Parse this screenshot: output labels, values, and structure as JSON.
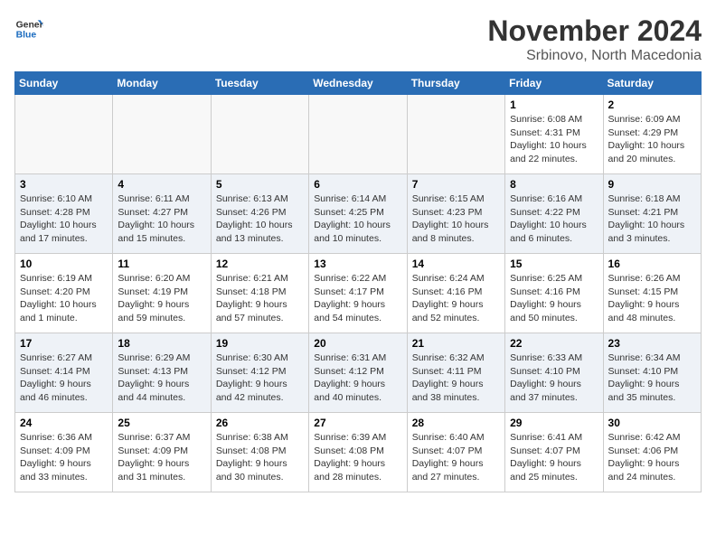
{
  "header": {
    "logo_line1": "General",
    "logo_line2": "Blue",
    "month_title": "November 2024",
    "location": "Srbinovo, North Macedonia"
  },
  "days_of_week": [
    "Sunday",
    "Monday",
    "Tuesday",
    "Wednesday",
    "Thursday",
    "Friday",
    "Saturday"
  ],
  "weeks": [
    [
      {
        "day": "",
        "info": ""
      },
      {
        "day": "",
        "info": ""
      },
      {
        "day": "",
        "info": ""
      },
      {
        "day": "",
        "info": ""
      },
      {
        "day": "",
        "info": ""
      },
      {
        "day": "1",
        "info": "Sunrise: 6:08 AM\nSunset: 4:31 PM\nDaylight: 10 hours\nand 22 minutes."
      },
      {
        "day": "2",
        "info": "Sunrise: 6:09 AM\nSunset: 4:29 PM\nDaylight: 10 hours\nand 20 minutes."
      }
    ],
    [
      {
        "day": "3",
        "info": "Sunrise: 6:10 AM\nSunset: 4:28 PM\nDaylight: 10 hours\nand 17 minutes."
      },
      {
        "day": "4",
        "info": "Sunrise: 6:11 AM\nSunset: 4:27 PM\nDaylight: 10 hours\nand 15 minutes."
      },
      {
        "day": "5",
        "info": "Sunrise: 6:13 AM\nSunset: 4:26 PM\nDaylight: 10 hours\nand 13 minutes."
      },
      {
        "day": "6",
        "info": "Sunrise: 6:14 AM\nSunset: 4:25 PM\nDaylight: 10 hours\nand 10 minutes."
      },
      {
        "day": "7",
        "info": "Sunrise: 6:15 AM\nSunset: 4:23 PM\nDaylight: 10 hours\nand 8 minutes."
      },
      {
        "day": "8",
        "info": "Sunrise: 6:16 AM\nSunset: 4:22 PM\nDaylight: 10 hours\nand 6 minutes."
      },
      {
        "day": "9",
        "info": "Sunrise: 6:18 AM\nSunset: 4:21 PM\nDaylight: 10 hours\nand 3 minutes."
      }
    ],
    [
      {
        "day": "10",
        "info": "Sunrise: 6:19 AM\nSunset: 4:20 PM\nDaylight: 10 hours\nand 1 minute."
      },
      {
        "day": "11",
        "info": "Sunrise: 6:20 AM\nSunset: 4:19 PM\nDaylight: 9 hours\nand 59 minutes."
      },
      {
        "day": "12",
        "info": "Sunrise: 6:21 AM\nSunset: 4:18 PM\nDaylight: 9 hours\nand 57 minutes."
      },
      {
        "day": "13",
        "info": "Sunrise: 6:22 AM\nSunset: 4:17 PM\nDaylight: 9 hours\nand 54 minutes."
      },
      {
        "day": "14",
        "info": "Sunrise: 6:24 AM\nSunset: 4:16 PM\nDaylight: 9 hours\nand 52 minutes."
      },
      {
        "day": "15",
        "info": "Sunrise: 6:25 AM\nSunset: 4:16 PM\nDaylight: 9 hours\nand 50 minutes."
      },
      {
        "day": "16",
        "info": "Sunrise: 6:26 AM\nSunset: 4:15 PM\nDaylight: 9 hours\nand 48 minutes."
      }
    ],
    [
      {
        "day": "17",
        "info": "Sunrise: 6:27 AM\nSunset: 4:14 PM\nDaylight: 9 hours\nand 46 minutes."
      },
      {
        "day": "18",
        "info": "Sunrise: 6:29 AM\nSunset: 4:13 PM\nDaylight: 9 hours\nand 44 minutes."
      },
      {
        "day": "19",
        "info": "Sunrise: 6:30 AM\nSunset: 4:12 PM\nDaylight: 9 hours\nand 42 minutes."
      },
      {
        "day": "20",
        "info": "Sunrise: 6:31 AM\nSunset: 4:12 PM\nDaylight: 9 hours\nand 40 minutes."
      },
      {
        "day": "21",
        "info": "Sunrise: 6:32 AM\nSunset: 4:11 PM\nDaylight: 9 hours\nand 38 minutes."
      },
      {
        "day": "22",
        "info": "Sunrise: 6:33 AM\nSunset: 4:10 PM\nDaylight: 9 hours\nand 37 minutes."
      },
      {
        "day": "23",
        "info": "Sunrise: 6:34 AM\nSunset: 4:10 PM\nDaylight: 9 hours\nand 35 minutes."
      }
    ],
    [
      {
        "day": "24",
        "info": "Sunrise: 6:36 AM\nSunset: 4:09 PM\nDaylight: 9 hours\nand 33 minutes."
      },
      {
        "day": "25",
        "info": "Sunrise: 6:37 AM\nSunset: 4:09 PM\nDaylight: 9 hours\nand 31 minutes."
      },
      {
        "day": "26",
        "info": "Sunrise: 6:38 AM\nSunset: 4:08 PM\nDaylight: 9 hours\nand 30 minutes."
      },
      {
        "day": "27",
        "info": "Sunrise: 6:39 AM\nSunset: 4:08 PM\nDaylight: 9 hours\nand 28 minutes."
      },
      {
        "day": "28",
        "info": "Sunrise: 6:40 AM\nSunset: 4:07 PM\nDaylight: 9 hours\nand 27 minutes."
      },
      {
        "day": "29",
        "info": "Sunrise: 6:41 AM\nSunset: 4:07 PM\nDaylight: 9 hours\nand 25 minutes."
      },
      {
        "day": "30",
        "info": "Sunrise: 6:42 AM\nSunset: 4:06 PM\nDaylight: 9 hours\nand 24 minutes."
      }
    ]
  ]
}
